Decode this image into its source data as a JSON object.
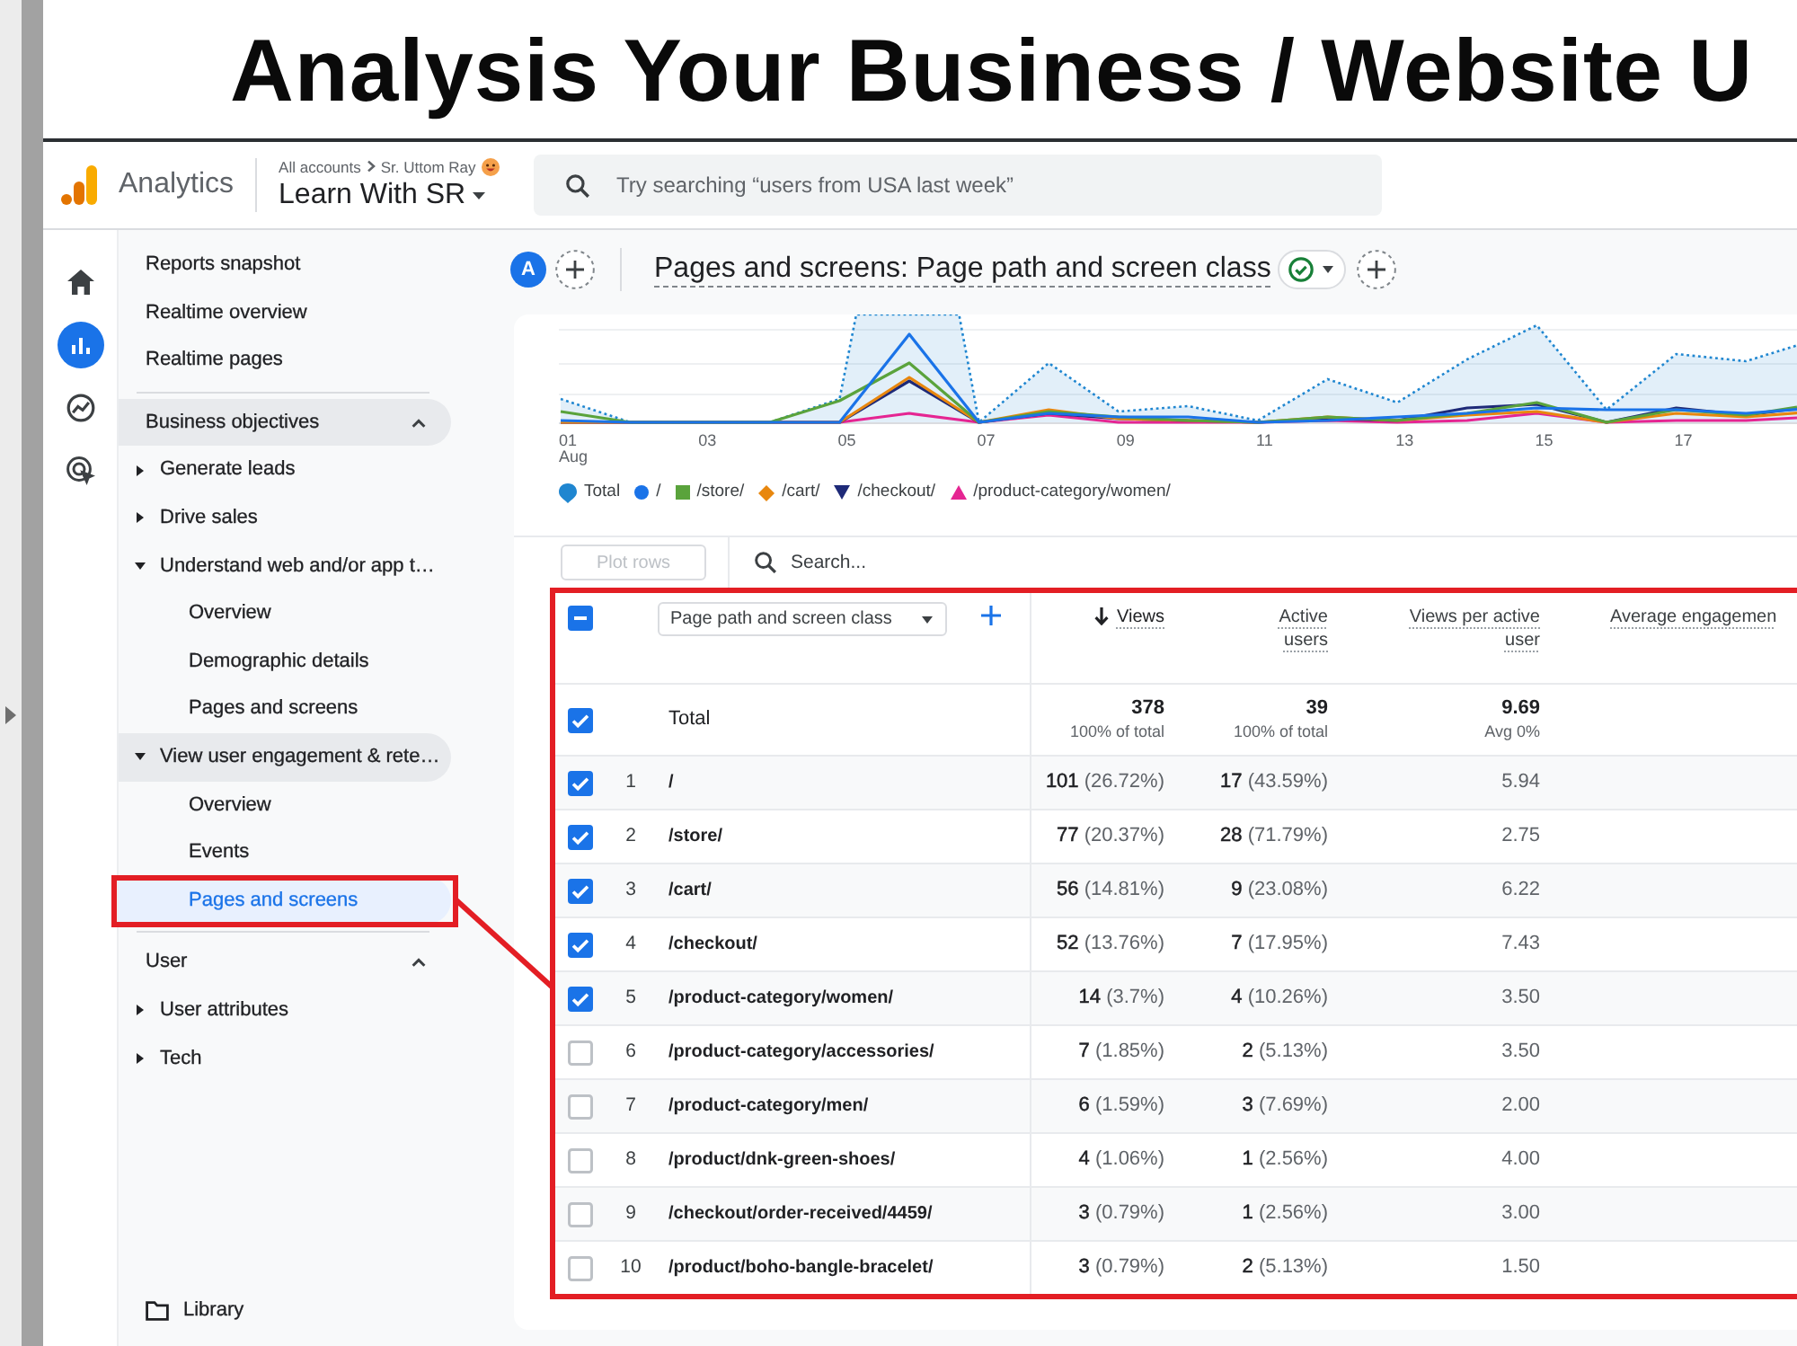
{
  "slide": {
    "title": "Analysis Your Business / Website U"
  },
  "app_header": {
    "product": "Analytics",
    "breadcrumb": [
      "All accounts",
      "Sr. Uttom Ray"
    ],
    "property": "Learn With SR",
    "search": {
      "placeholder": "Try searching “users from USA last week”"
    }
  },
  "rail": {
    "items": [
      {
        "kind": "home",
        "selected": false
      },
      {
        "kind": "reports",
        "selected": true
      },
      {
        "kind": "explore",
        "selected": false
      },
      {
        "kind": "advertising",
        "selected": false
      }
    ]
  },
  "sidebar": {
    "items": [
      {
        "kind": "link",
        "label": "Reports snapshot",
        "selected": false
      },
      {
        "kind": "link",
        "label": "Realtime overview",
        "selected": false
      },
      {
        "kind": "link",
        "label": "Realtime pages",
        "selected": false
      },
      {
        "kind": "section",
        "label": "Business objectives",
        "expanded": true,
        "highlighted": true,
        "children": [
          {
            "kind": "group",
            "label": "Generate leads",
            "expanded": false,
            "highlighted": false
          },
          {
            "kind": "group",
            "label": "Drive sales",
            "expanded": false,
            "highlighted": false
          },
          {
            "kind": "group",
            "label": "Understand web and/or app t…",
            "expanded": true,
            "highlighted": false,
            "children": [
              {
                "kind": "link",
                "label": "Overview",
                "selected": false
              },
              {
                "kind": "link",
                "label": "Demographic details",
                "selected": false
              },
              {
                "kind": "link",
                "label": "Pages and screens",
                "selected": false
              }
            ]
          },
          {
            "kind": "group",
            "label": "View user engagement & rete…",
            "expanded": true,
            "highlighted": true,
            "children": [
              {
                "kind": "link",
                "label": "Overview",
                "selected": false
              },
              {
                "kind": "link",
                "label": "Events",
                "selected": false
              },
              {
                "kind": "link",
                "label": "Pages and screens",
                "selected": true
              }
            ]
          }
        ]
      },
      {
        "kind": "section",
        "label": "User",
        "expanded": true,
        "highlighted": false,
        "children": [
          {
            "kind": "group",
            "label": "User attributes",
            "expanded": false,
            "highlighted": false
          },
          {
            "kind": "group",
            "label": "Tech",
            "expanded": false,
            "highlighted": false
          }
        ]
      }
    ],
    "footer": {
      "label": "Library"
    }
  },
  "report_bar": {
    "comparison": "A",
    "title": "Pages and screens: Page path and screen class"
  },
  "chart": {
    "x_labels": [
      "01",
      "03",
      "05",
      "07",
      "09",
      "11",
      "13",
      "15",
      "17"
    ],
    "x_sublabel": "Aug",
    "legend": [
      {
        "kind": "area",
        "label": "Total",
        "color": "#1f86d0"
      },
      {
        "kind": "circle",
        "label": "/",
        "color": "#1a73e8"
      },
      {
        "kind": "square",
        "label": "/store/",
        "color": "#5aa33c"
      },
      {
        "kind": "diamond",
        "label": "/cart/",
        "color": "#e8870e"
      },
      {
        "kind": "down",
        "label": "/checkout/",
        "color": "#1e2a78"
      },
      {
        "kind": "up",
        "label": "/product-category/women/",
        "color": "#e52592"
      }
    ]
  },
  "table": {
    "plot_button": {
      "label": "Plot rows",
      "disabled": true
    },
    "search": {
      "placeholder": "Search..."
    },
    "select_all": {
      "indeterminate": true
    },
    "dimension": "Page path and screen class",
    "columns": [
      {
        "label": "Views",
        "sorted": true
      },
      {
        "label": "Active users",
        "sorted": false
      },
      {
        "label": "Views per active user",
        "sorted": false
      },
      {
        "label": "Average engagemen",
        "sorted": false
      }
    ],
    "total": {
      "label": "Total",
      "checked": true,
      "cells": [
        {
          "value": "378",
          "note": "100% of total"
        },
        {
          "value": "39",
          "note": "100% of total"
        },
        {
          "value": "9.69",
          "note": "Avg 0%"
        }
      ]
    },
    "rows": [
      {
        "rank": "1",
        "path": "/",
        "checked": true,
        "cells": [
          "**101** (26.72%)",
          "**17** (43.59%)",
          "5.94"
        ]
      },
      {
        "rank": "2",
        "path": "/store/",
        "checked": true,
        "cells": [
          "**77** (20.37%)",
          "**28** (71.79%)",
          "2.75"
        ]
      },
      {
        "rank": "3",
        "path": "/cart/",
        "checked": true,
        "cells": [
          "**56** (14.81%)",
          "**9** (23.08%)",
          "6.22"
        ]
      },
      {
        "rank": "4",
        "path": "/checkout/",
        "checked": true,
        "cells": [
          "**52** (13.76%)",
          "**7** (17.95%)",
          "7.43"
        ]
      },
      {
        "rank": "5",
        "path": "/product-category/women/",
        "checked": true,
        "cells": [
          "**14** (3.7%)",
          "**4** (10.26%)",
          "3.50"
        ]
      },
      {
        "rank": "6",
        "path": "/product-category/accessories/",
        "checked": false,
        "cells": [
          "**7** (1.85%)",
          "**2** (5.13%)",
          "3.50"
        ]
      },
      {
        "rank": "7",
        "path": "/product-category/men/",
        "checked": false,
        "cells": [
          "**6** (1.59%)",
          "**3** (7.69%)",
          "2.00"
        ]
      },
      {
        "rank": "8",
        "path": "/product/dnk-green-shoes/",
        "checked": false,
        "cells": [
          "**4** (1.06%)",
          "**1** (2.56%)",
          "4.00"
        ]
      },
      {
        "rank": "9",
        "path": "/checkout/order-received/4459/",
        "checked": false,
        "cells": [
          "**3** (0.79%)",
          "**1** (2.56%)",
          "3.00"
        ]
      },
      {
        "rank": "10",
        "path": "/product/boho-bangle-bracelet/",
        "checked": false,
        "cells": [
          "**3** (0.79%)",
          "**2** (5.13%)",
          "1.50"
        ]
      }
    ]
  }
}
